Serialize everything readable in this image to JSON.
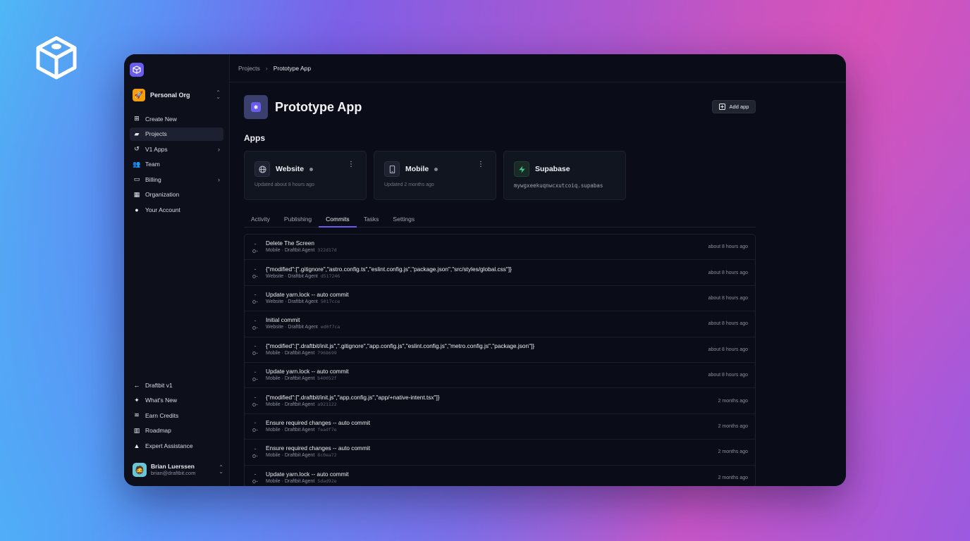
{
  "breadcrumb": {
    "parent": "Projects",
    "separator": "›",
    "current": "Prototype App"
  },
  "sidebar": {
    "org_name": "Personal Org",
    "nav": [
      {
        "label": "Create New",
        "icon": "plus-square-icon",
        "chevron": false,
        "active": false
      },
      {
        "label": "Projects",
        "icon": "folder-open-icon",
        "chevron": false,
        "active": true
      },
      {
        "label": "V1 Apps",
        "icon": "history-icon",
        "chevron": true,
        "active": false
      },
      {
        "label": "Team",
        "icon": "users-icon",
        "chevron": false,
        "active": false
      },
      {
        "label": "Billing",
        "icon": "credit-card-icon",
        "chevron": true,
        "active": false
      },
      {
        "label": "Organization",
        "icon": "building-icon",
        "chevron": false,
        "active": false
      },
      {
        "label": "Your Account",
        "icon": "user-icon",
        "chevron": false,
        "active": false
      }
    ],
    "nav_bottom": [
      {
        "label": "Draftbit v1",
        "icon": "arrow-left-icon"
      },
      {
        "label": "What's New",
        "icon": "sparkles-icon"
      },
      {
        "label": "Earn Credits",
        "icon": "coins-icon"
      },
      {
        "label": "Roadmap",
        "icon": "map-icon"
      },
      {
        "label": "Expert Assistance",
        "icon": "user-tie-icon"
      }
    ],
    "user": {
      "name": "Brian Luerssen",
      "email": "brian@draftbit.com"
    }
  },
  "project": {
    "title": "Prototype App",
    "add_app_label": "Add app",
    "apps_heading": "Apps"
  },
  "apps": [
    {
      "name": "Website",
      "icon": "globe-icon",
      "status": "Updated about 8 hours ago",
      "menu": true
    },
    {
      "name": "Mobile",
      "icon": "phone-icon",
      "status": "Updated 2 months ago",
      "menu": true
    },
    {
      "name": "Supabase",
      "icon": "supabase-bolt-icon",
      "url": "mywgxeekuqnwcxutcoiq.supabas",
      "menu": false
    }
  ],
  "tabs": [
    "Activity",
    "Publishing",
    "Commits",
    "Tasks",
    "Settings"
  ],
  "active_tab": "Commits",
  "commits": [
    {
      "message": "Delete The Screen",
      "app": "Mobile",
      "author": "Draftbit Agent",
      "sha": "322d17d",
      "time": "about 8 hours ago"
    },
    {
      "message": "{\"modified\":[\".gitignore\",\"astro.config.ts\",\"eslint.config.js\",\"package.json\",\"src/styles/global.css\"]}",
      "app": "Website",
      "author": "Draftbit Agent",
      "sha": "d517246",
      "time": "about 8 hours ago"
    },
    {
      "message": "Update yarn.lock -- auto commit",
      "app": "Website",
      "author": "Draftbit Agent",
      "sha": "5017cce",
      "time": "about 8 hours ago"
    },
    {
      "message": "Initial commit",
      "app": "Website",
      "author": "Draftbit Agent",
      "sha": "ed0f7ca",
      "time": "about 8 hours ago"
    },
    {
      "message": "{\"modified\":[\".draftbit/init.js\",\".gitignore\",\"app.config.js\",\"eslint.config.js\",\"metro.config.js\",\"package.json\"]}",
      "app": "Mobile",
      "author": "Draftbit Agent",
      "sha": "7968699",
      "time": "about 8 hours ago"
    },
    {
      "message": "Update yarn.lock -- auto commit",
      "app": "Mobile",
      "author": "Draftbit Agent",
      "sha": "b40052f",
      "time": "about 8 hours ago"
    },
    {
      "message": "{\"modified\":[\".draftbit/init.js\",\"app.config.js\",\"app/+native-intent.tsx\"]}",
      "app": "Mobile",
      "author": "Draftbit Agent",
      "sha": "a921122",
      "time": "2 months ago"
    },
    {
      "message": "Ensure required changes -- auto commit",
      "app": "Mobile",
      "author": "Draftbit Agent",
      "sha": "feadf7e",
      "time": "2 months ago"
    },
    {
      "message": "Ensure required changes -- auto commit",
      "app": "Mobile",
      "author": "Draftbit Agent",
      "sha": "8c0ea72",
      "time": "2 months ago"
    },
    {
      "message": "Update yarn.lock -- auto commit",
      "app": "Mobile",
      "author": "Draftbit Agent",
      "sha": "5dad92e",
      "time": "2 months ago"
    }
  ],
  "colors": {
    "accent": "#6b5cf0",
    "org_badge": "#f59e0b",
    "supabase": "#3ecf8e",
    "window_bg": "#0a0d17"
  }
}
